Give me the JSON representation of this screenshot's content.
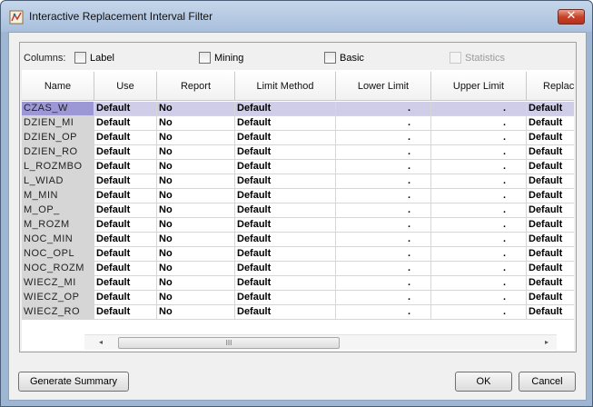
{
  "window": {
    "title": "Interactive Replacement Interval Filter",
    "close_label": "✕"
  },
  "columns_options": {
    "label": "Columns:",
    "options": [
      {
        "label": "Label",
        "checked": false,
        "enabled": true
      },
      {
        "label": "Mining",
        "checked": false,
        "enabled": true
      },
      {
        "label": "Basic",
        "checked": false,
        "enabled": true
      },
      {
        "label": "Statistics",
        "checked": false,
        "enabled": false
      }
    ]
  },
  "table": {
    "headers": [
      "Name",
      "Use",
      "Report",
      "Limit Method",
      "Lower Limit",
      "Upper Limit",
      "Replac"
    ],
    "rows": [
      {
        "name": "CZAS_W",
        "use": "Default",
        "report": "No",
        "limit_method": "Default",
        "lower": ".",
        "upper": ".",
        "replacement": "Default",
        "selected": true
      },
      {
        "name": "DZIEN_MI",
        "use": "Default",
        "report": "No",
        "limit_method": "Default",
        "lower": ".",
        "upper": ".",
        "replacement": "Default"
      },
      {
        "name": "DZIEN_OP",
        "use": "Default",
        "report": "No",
        "limit_method": "Default",
        "lower": ".",
        "upper": ".",
        "replacement": "Default"
      },
      {
        "name": "DZIEN_RO",
        "use": "Default",
        "report": "No",
        "limit_method": "Default",
        "lower": ".",
        "upper": ".",
        "replacement": "Default"
      },
      {
        "name": "L_ROZMBO",
        "use": "Default",
        "report": "No",
        "limit_method": "Default",
        "lower": ".",
        "upper": ".",
        "replacement": "Default"
      },
      {
        "name": "L_WIAD",
        "use": "Default",
        "report": "No",
        "limit_method": "Default",
        "lower": ".",
        "upper": ".",
        "replacement": "Default"
      },
      {
        "name": "M_MIN",
        "use": "Default",
        "report": "No",
        "limit_method": "Default",
        "lower": ".",
        "upper": ".",
        "replacement": "Default"
      },
      {
        "name": "M_OP_",
        "use": "Default",
        "report": "No",
        "limit_method": "Default",
        "lower": ".",
        "upper": ".",
        "replacement": "Default"
      },
      {
        "name": "M_ROZM",
        "use": "Default",
        "report": "No",
        "limit_method": "Default",
        "lower": ".",
        "upper": ".",
        "replacement": "Default"
      },
      {
        "name": "NOC_MIN",
        "use": "Default",
        "report": "No",
        "limit_method": "Default",
        "lower": ".",
        "upper": ".",
        "replacement": "Default"
      },
      {
        "name": "NOC_OPL",
        "use": "Default",
        "report": "No",
        "limit_method": "Default",
        "lower": ".",
        "upper": ".",
        "replacement": "Default"
      },
      {
        "name": "NOC_ROZM",
        "use": "Default",
        "report": "No",
        "limit_method": "Default",
        "lower": ".",
        "upper": ".",
        "replacement": "Default"
      },
      {
        "name": "WIECZ_MI",
        "use": "Default",
        "report": "No",
        "limit_method": "Default",
        "lower": ".",
        "upper": ".",
        "replacement": "Default"
      },
      {
        "name": "WIECZ_OP",
        "use": "Default",
        "report": "No",
        "limit_method": "Default",
        "lower": ".",
        "upper": ".",
        "replacement": "Default"
      },
      {
        "name": "WIECZ_RO",
        "use": "Default",
        "report": "No",
        "limit_method": "Default",
        "lower": ".",
        "upper": ".",
        "replacement": "Default"
      }
    ]
  },
  "scrollbar": {
    "left_arrow": "◂",
    "right_arrow": "▸",
    "grip": "III"
  },
  "buttons": {
    "generate_summary": "Generate Summary",
    "ok": "OK",
    "cancel": "Cancel"
  },
  "colors": {
    "selected_name": "#9c98d6",
    "selected_row": "#cfcde8",
    "name_column": "#d6d6d6"
  }
}
